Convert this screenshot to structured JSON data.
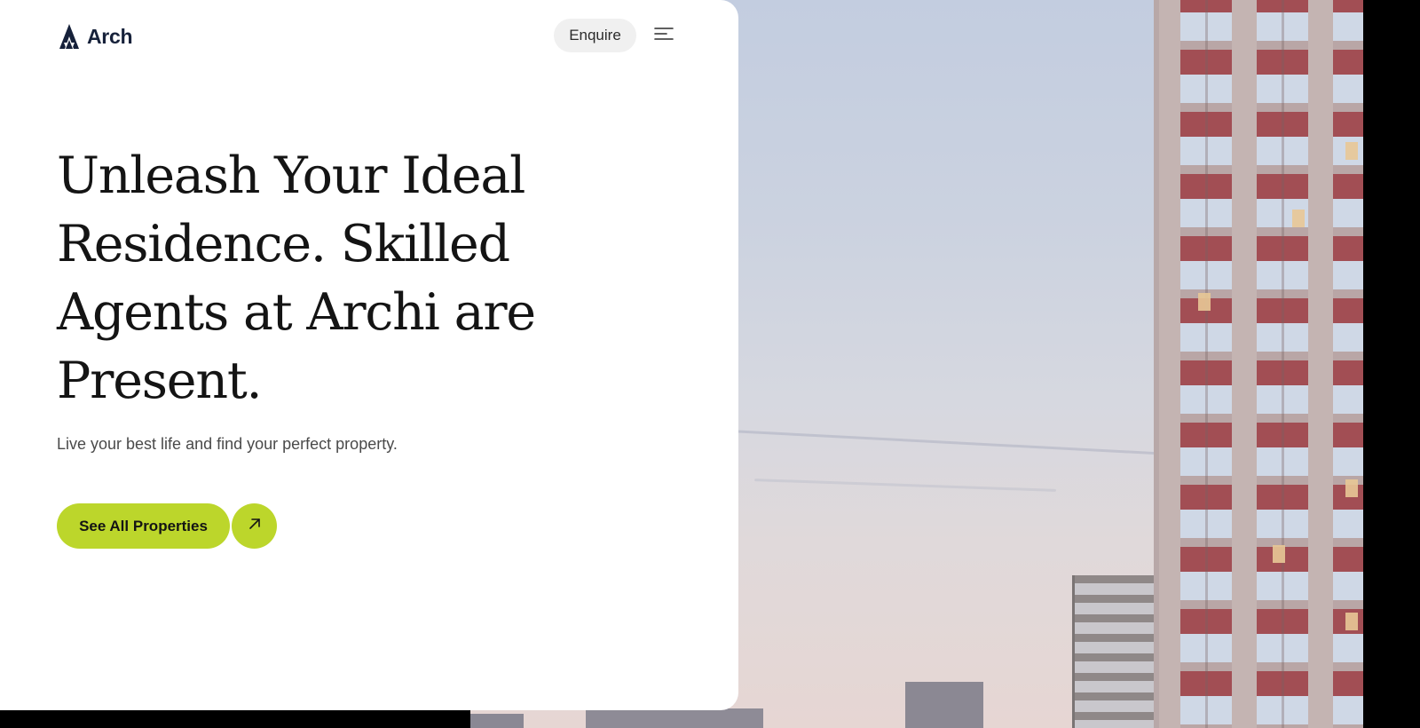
{
  "header": {
    "brand_name": "Arch",
    "logo_icon": "arch-a-logo-icon",
    "enquire_label": "Enquire",
    "menu_icon": "menu-icon"
  },
  "hero": {
    "headline": "Unleash Your Ideal Residence. Skilled Agents at Archi are Present.",
    "subtext": "Live your best life and find your perfect property.",
    "cta_label": "See All Properties",
    "cta_icon": "arrow-up-right-icon"
  },
  "colors": {
    "accent": "#bcd62b",
    "brand_navy": "#16213a",
    "text_dark": "#141414",
    "pill_gray": "#f0f0f0"
  }
}
